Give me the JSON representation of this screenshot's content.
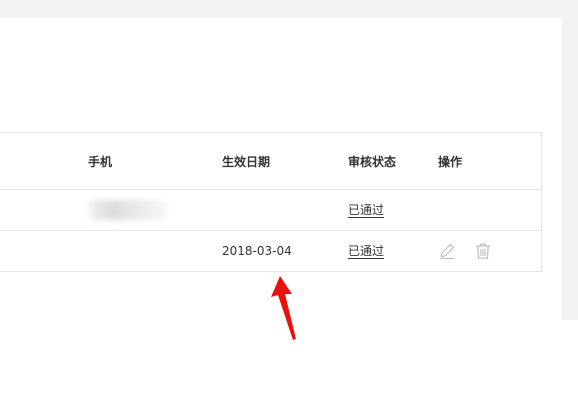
{
  "table": {
    "columns": {
      "phone": "手机",
      "effective_date": "生效日期",
      "review_status": "审核状态",
      "actions": "操作"
    },
    "rows": [
      {
        "phone": "",
        "effective_date": "",
        "review_status": "已通过"
      },
      {
        "phone": "",
        "effective_date": "2018-03-04",
        "review_status": "已通过"
      }
    ]
  },
  "icons": {
    "edit": "pencil-icon",
    "delete": "trash-icon"
  },
  "colors": {
    "annotation_arrow": "#e8120c",
    "border": "#e6e6e6",
    "background_band": "#f2f2f2"
  }
}
